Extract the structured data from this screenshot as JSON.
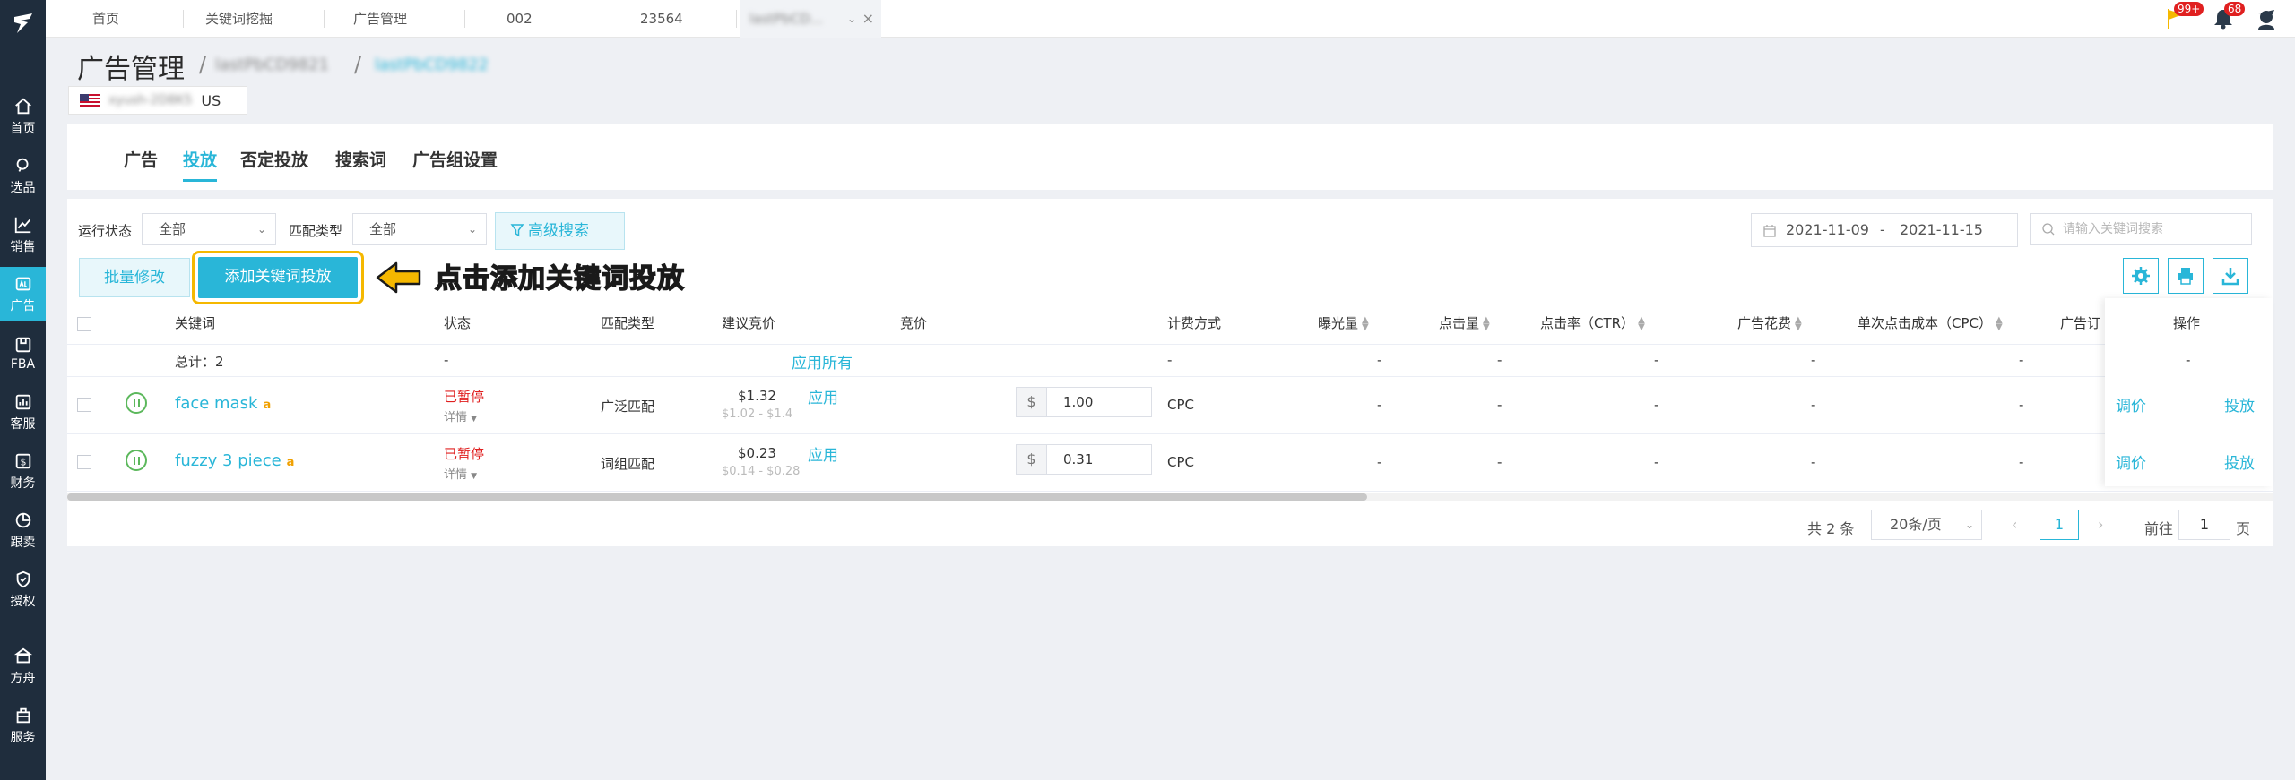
{
  "tabs": [
    {
      "label": "首页"
    },
    {
      "label": "关键词挖掘"
    },
    {
      "label": "广告管理"
    },
    {
      "label": "002"
    },
    {
      "label": "23564"
    },
    {
      "label": "lastPbCD...",
      "blurred": true
    }
  ],
  "header": {
    "flag_badge": "99+",
    "bell_badge": "68"
  },
  "sidebar": {
    "items": [
      {
        "label": "首页",
        "icon": "home-icon"
      },
      {
        "label": "选品",
        "icon": "search-icon"
      },
      {
        "label": "销售",
        "icon": "chart-icon"
      },
      {
        "label": "广告",
        "icon": "ad-icon",
        "active": true
      },
      {
        "label": "FBA",
        "icon": "box-icon"
      },
      {
        "label": "客服",
        "icon": "service-icon"
      },
      {
        "label": "财务",
        "icon": "finance-icon"
      },
      {
        "label": "跟卖",
        "icon": "pie-icon"
      },
      {
        "label": "授权",
        "icon": "shield-icon"
      },
      {
        "label": "方舟",
        "icon": "ark-icon"
      },
      {
        "label": "服务",
        "icon": "building-icon"
      }
    ]
  },
  "page": {
    "title": "广告管理",
    "crumb1": "lastPbCD9821",
    "crumb2": "lastPbCD9822",
    "store_name": "xyush-2D8K5",
    "store_region": "US"
  },
  "main_tabs": [
    {
      "label": "广告"
    },
    {
      "label": "投放",
      "active": true
    },
    {
      "label": "否定投放"
    },
    {
      "label": "搜索词"
    },
    {
      "label": "广告组设置"
    }
  ],
  "filters": {
    "run_status_label": "运行状态",
    "run_status_value": "全部",
    "match_type_label": "匹配类型",
    "match_type_value": "全部",
    "advanced_search": "高级搜索",
    "date_start": "2021-11-09",
    "date_sep": "-",
    "date_end": "2021-11-15",
    "keyword_placeholder": "请输入关键词搜索"
  },
  "actions": {
    "batch_edit": "批量修改",
    "add_keyword": "添加关键词投放",
    "callout": "点击添加关键词投放"
  },
  "table": {
    "headers": {
      "keyword": "关键词",
      "status": "状态",
      "match_type": "匹配类型",
      "suggested_bid": "建议竞价",
      "bid": "竞价",
      "billing": "计费方式",
      "impressions": "曝光量",
      "clicks": "点击量",
      "ctr": "点击率（CTR）",
      "spend": "广告花费",
      "cpc": "单次点击成本（CPC）",
      "orders": "广告订",
      "operations": "操作"
    },
    "summary": {
      "label": "总计：2",
      "status": "-",
      "apply_all": "应用所有",
      "billing": "-",
      "impressions": "-",
      "clicks": "-",
      "ctr": "-",
      "spend": "-",
      "cpc": "-",
      "ops": "-"
    },
    "rows": [
      {
        "keyword": "face mask",
        "status": "已暂停",
        "detail": "详情",
        "match_type": "广泛匹配",
        "suggested": "$1.32",
        "suggested_range": "$1.02 - $1.4",
        "apply": "应用",
        "currency": "$",
        "bid": "1.00",
        "billing": "CPC",
        "impressions": "-",
        "clicks": "-",
        "ctr": "-",
        "spend": "-",
        "cpc": "-",
        "op_adjust": "调价",
        "op_place": "投放"
      },
      {
        "keyword": "fuzzy 3 piece",
        "status": "已暂停",
        "detail": "详情",
        "match_type": "词组匹配",
        "suggested": "$0.23",
        "suggested_range": "$0.14 - $0.28",
        "apply": "应用",
        "currency": "$",
        "bid": "0.31",
        "billing": "CPC",
        "impressions": "-",
        "clicks": "-",
        "ctr": "-",
        "spend": "-",
        "cpc": "-",
        "op_adjust": "调价",
        "op_place": "投放"
      }
    ]
  },
  "pagination": {
    "total": "共 2 条",
    "page_size": "20条/页",
    "current": "1",
    "goto_label": "前往",
    "goto_value": "1",
    "page_suffix": "页"
  },
  "colors": {
    "accent": "#29b6d8",
    "sidebar": "#1f2d3d",
    "warning": "#f5b800",
    "danger": "#e02020",
    "success": "#5cb85c"
  }
}
